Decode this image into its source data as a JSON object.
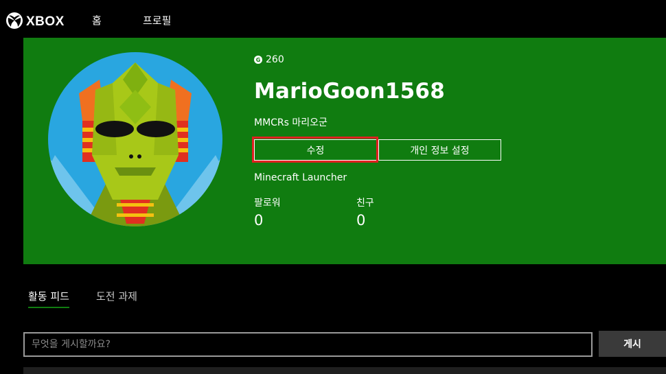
{
  "nav": {
    "logo_text": "XBOX",
    "links": [
      "홈",
      "프로필"
    ]
  },
  "profile": {
    "gamerscore": "260",
    "gamerscore_badge": "G",
    "gamertag": "MarioGoon1568",
    "real_name": "MMCRs 마리오군",
    "edit_button": "수정",
    "privacy_button": "개인 정보 설정",
    "presence": "Minecraft Launcher",
    "followers_label": "팔로워",
    "followers_count": "0",
    "friends_label": "친구",
    "friends_count": "0",
    "avatar_icon": "tribal-mask-avatar-icon"
  },
  "tabs": [
    "활동 피드",
    "도전 과제"
  ],
  "post": {
    "placeholder": "무엇을 게시할까요?",
    "submit_label": "게시"
  },
  "colors": {
    "banner": "#107c10",
    "highlight": "#e02020",
    "background": "#000000"
  }
}
